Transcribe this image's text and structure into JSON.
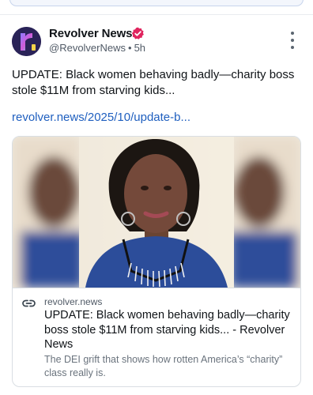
{
  "post": {
    "author_name": "Revolver News",
    "handle": "@RevolverNews",
    "separator": "•",
    "time": "5h",
    "text": "UPDATE: Black women behaving badly—charity boss stole $11M from starving kids...",
    "link_text": "revolver.news/2025/10/update-b..."
  },
  "card": {
    "domain": "revolver.news",
    "title": "UPDATE: Black women behaving badly—charity boss stole $11M from starving kids... - Revolver News",
    "description": "The DEI grift that shows how rotten America’s “charity” class really is."
  },
  "icons": {
    "avatar": "revolver-logo-avatar",
    "verified": "verified-badge-icon",
    "more": "more-vertical-icon",
    "link": "link-icon"
  },
  "colors": {
    "link": "#1f5fbf",
    "verified_badge": "#e0245e",
    "avatar_bg": "#2a2358"
  }
}
